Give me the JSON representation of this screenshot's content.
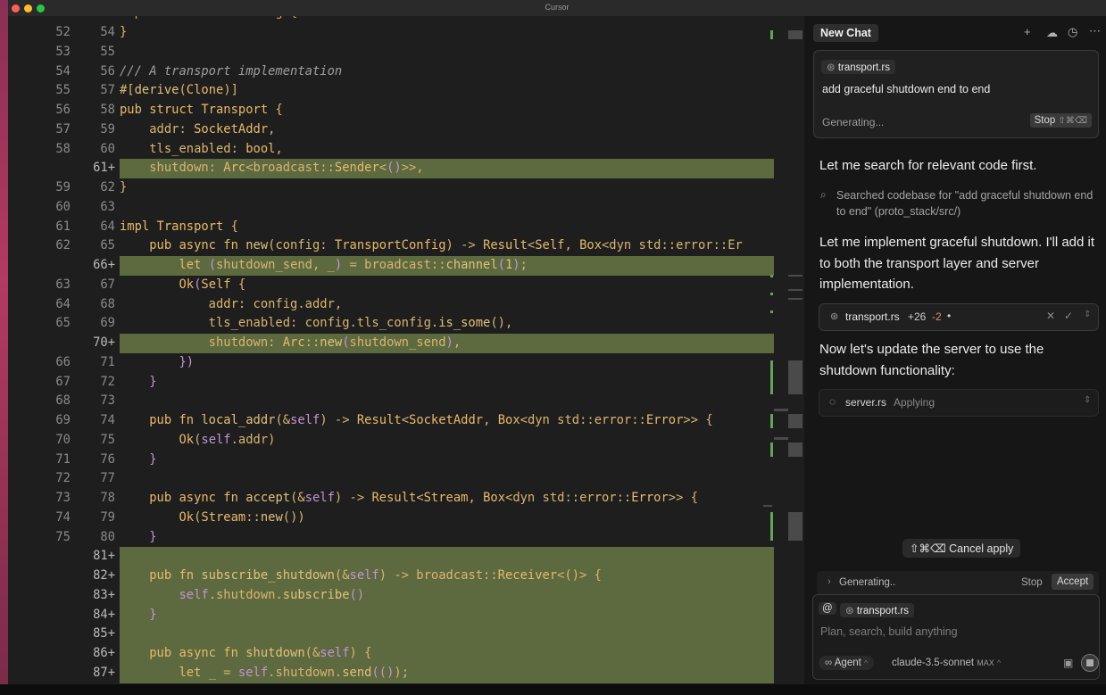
{
  "window": {
    "title": "Cursor"
  },
  "code_lines": [
    {
      "old": "52",
      "new": "54",
      "added": false,
      "code": [
        [
          "}",
          "t"
        ]
      ]
    },
    {
      "old": "53",
      "new": "55",
      "added": false,
      "code": []
    },
    {
      "old": "54",
      "new": "56",
      "added": false,
      "code": [
        [
          "/// A transport implementation",
          "c"
        ]
      ]
    },
    {
      "old": "55",
      "new": "57",
      "added": false,
      "code": [
        [
          "#[",
          "t"
        ],
        [
          "derive",
          "f"
        ],
        [
          "(",
          "t"
        ],
        [
          "Clone",
          "k"
        ],
        [
          ")]",
          "t"
        ]
      ]
    },
    {
      "old": "56",
      "new": "58",
      "added": false,
      "code": [
        [
          "pub struct ",
          "k"
        ],
        [
          "Transport",
          "k"
        ],
        [
          " {",
          "t"
        ]
      ]
    },
    {
      "old": "57",
      "new": "59",
      "added": false,
      "code": [
        [
          "    addr: ",
          "t"
        ],
        [
          "SocketAddr",
          "k"
        ],
        [
          ",",
          "t"
        ]
      ]
    },
    {
      "old": "58",
      "new": "60",
      "added": false,
      "code": [
        [
          "    tls_enabled: ",
          "t"
        ],
        [
          "bool",
          "k"
        ],
        [
          ",",
          "t"
        ]
      ]
    },
    {
      "old": "",
      "new": "61+",
      "added": true,
      "code": [
        [
          "    shutdown: ",
          "t"
        ],
        [
          "Arc",
          "k"
        ],
        [
          "<broadcast::",
          "t"
        ],
        [
          "Sender",
          "k"
        ],
        [
          "<",
          "t"
        ],
        [
          "()",
          "p"
        ],
        [
          ">>,",
          "t"
        ]
      ]
    },
    {
      "old": "59",
      "new": "62",
      "added": false,
      "code": [
        [
          "}",
          "t"
        ]
      ]
    },
    {
      "old": "60",
      "new": "63",
      "added": false,
      "code": []
    },
    {
      "old": "61",
      "new": "64",
      "added": false,
      "code": [
        [
          "impl ",
          "k"
        ],
        [
          "Transport",
          "k"
        ],
        [
          " {",
          "t"
        ]
      ]
    },
    {
      "old": "62",
      "new": "65",
      "added": false,
      "code": [
        [
          "    pub async fn ",
          "k"
        ],
        [
          "new",
          "f"
        ],
        [
          "(config: ",
          "t"
        ],
        [
          "TransportConfig",
          "k"
        ],
        [
          ") -> ",
          "t"
        ],
        [
          "Result",
          "k"
        ],
        [
          "<",
          "t"
        ],
        [
          "Self",
          "k"
        ],
        [
          ", ",
          "t"
        ],
        [
          "Box",
          "k"
        ],
        [
          "<dyn std::error::Er",
          "t"
        ]
      ]
    },
    {
      "old": "",
      "new": "66+",
      "added": true,
      "code": [
        [
          "        let ",
          "k"
        ],
        [
          "(",
          "p"
        ],
        [
          "shutdown_send, _",
          "t"
        ],
        [
          ")",
          "p"
        ],
        [
          " = broadcast::",
          "t"
        ],
        [
          "channel",
          "f"
        ],
        [
          "(",
          "p"
        ],
        [
          "1",
          "f"
        ],
        [
          ")",
          "p"
        ],
        [
          ";",
          "t"
        ]
      ]
    },
    {
      "old": "63",
      "new": "67",
      "added": false,
      "code": [
        [
          "        Ok",
          "k"
        ],
        [
          "(",
          "p"
        ],
        [
          "Self",
          "k"
        ],
        [
          " {",
          "t"
        ]
      ]
    },
    {
      "old": "64",
      "new": "68",
      "added": false,
      "code": [
        [
          "            addr: config.addr,",
          "t"
        ]
      ]
    },
    {
      "old": "65",
      "new": "69",
      "added": false,
      "code": [
        [
          "            tls_enabled: config.tls_config.",
          "t"
        ],
        [
          "is_some",
          "f"
        ],
        [
          "(),",
          "t"
        ]
      ]
    },
    {
      "old": "",
      "new": "70+",
      "added": true,
      "code": [
        [
          "            shutdown: ",
          "t"
        ],
        [
          "Arc",
          "k"
        ],
        [
          "::",
          "t"
        ],
        [
          "new",
          "f"
        ],
        [
          "(",
          "p"
        ],
        [
          "shutdown_send",
          "t"
        ],
        [
          ")",
          "p"
        ],
        [
          ",",
          "t"
        ]
      ]
    },
    {
      "old": "66",
      "new": "71",
      "added": false,
      "code": [
        [
          "        })",
          "p"
        ]
      ]
    },
    {
      "old": "67",
      "new": "72",
      "added": false,
      "code": [
        [
          "    }",
          "p"
        ]
      ]
    },
    {
      "old": "68",
      "new": "73",
      "added": false,
      "code": []
    },
    {
      "old": "69",
      "new": "74",
      "added": false,
      "code": [
        [
          "    pub fn ",
          "k"
        ],
        [
          "local_addr",
          "f"
        ],
        [
          "(&",
          "t"
        ],
        [
          "self",
          "p"
        ],
        [
          ") -> ",
          "t"
        ],
        [
          "Result",
          "k"
        ],
        [
          "<",
          "t"
        ],
        [
          "SocketAddr",
          "k"
        ],
        [
          ", ",
          "t"
        ],
        [
          "Box",
          "k"
        ],
        [
          "<dyn std::error::",
          "t"
        ],
        [
          "Error",
          "k"
        ],
        [
          ">> {",
          "t"
        ]
      ]
    },
    {
      "old": "70",
      "new": "75",
      "added": false,
      "code": [
        [
          "        Ok",
          "k"
        ],
        [
          "(",
          "t"
        ],
        [
          "self",
          "p"
        ],
        [
          ".addr)",
          "t"
        ]
      ]
    },
    {
      "old": "71",
      "new": "76",
      "added": false,
      "code": [
        [
          "    }",
          "p"
        ]
      ]
    },
    {
      "old": "72",
      "new": "77",
      "added": false,
      "code": []
    },
    {
      "old": "73",
      "new": "78",
      "added": false,
      "code": [
        [
          "    pub async fn ",
          "k"
        ],
        [
          "accept",
          "f"
        ],
        [
          "(&",
          "t"
        ],
        [
          "self",
          "p"
        ],
        [
          ") -> ",
          "t"
        ],
        [
          "Result",
          "k"
        ],
        [
          "<",
          "t"
        ],
        [
          "Stream",
          "k"
        ],
        [
          ", ",
          "t"
        ],
        [
          "Box",
          "k"
        ],
        [
          "<dyn std::error::",
          "t"
        ],
        [
          "Error",
          "k"
        ],
        [
          ">> {",
          "t"
        ]
      ]
    },
    {
      "old": "74",
      "new": "79",
      "added": false,
      "code": [
        [
          "        Ok",
          "k"
        ],
        [
          "(",
          "t"
        ],
        [
          "Stream",
          "k"
        ],
        [
          "::",
          "t"
        ],
        [
          "new",
          "f"
        ],
        [
          "())",
          "t"
        ]
      ]
    },
    {
      "old": "75",
      "new": "80",
      "added": false,
      "code": [
        [
          "    }",
          "p"
        ]
      ]
    },
    {
      "old": "",
      "new": "81+",
      "added": true,
      "code": []
    },
    {
      "old": "",
      "new": "82+",
      "added": true,
      "code": [
        [
          "    pub fn ",
          "k"
        ],
        [
          "subscribe_shutdown",
          "f"
        ],
        [
          "(&",
          "t"
        ],
        [
          "self",
          "p"
        ],
        [
          ") -> broadcast::",
          "t"
        ],
        [
          "Receiver",
          "k"
        ],
        [
          "<()> {",
          "t"
        ]
      ]
    },
    {
      "old": "",
      "new": "83+",
      "added": true,
      "code": [
        [
          "        self",
          "p"
        ],
        [
          ".shutdown.",
          "t"
        ],
        [
          "subscribe",
          "f"
        ],
        [
          "()",
          "p"
        ]
      ]
    },
    {
      "old": "",
      "new": "84+",
      "added": true,
      "code": [
        [
          "    }",
          "p"
        ]
      ]
    },
    {
      "old": "",
      "new": "85+",
      "added": true,
      "code": []
    },
    {
      "old": "",
      "new": "86+",
      "added": true,
      "code": [
        [
          "    pub async fn ",
          "k"
        ],
        [
          "shutdown",
          "f"
        ],
        [
          "(&",
          "t"
        ],
        [
          "self",
          "p"
        ],
        [
          ") {",
          "t"
        ]
      ]
    },
    {
      "old": "",
      "new": "87+",
      "added": true,
      "code": [
        [
          "        let ",
          "k"
        ],
        [
          "_ = ",
          "t"
        ],
        [
          "self",
          "p"
        ],
        [
          ".shutdown.",
          "t"
        ],
        [
          "send",
          "f"
        ],
        [
          "(",
          "p"
        ],
        [
          "()",
          "p"
        ],
        [
          ");",
          "t"
        ]
      ]
    }
  ],
  "chat": {
    "tab_label": "New Chat",
    "header_icons": [
      "plus-icon",
      "cloud-icon",
      "history-icon",
      "more-icon"
    ],
    "prompt": {
      "file_chip": "transport.rs",
      "text": "add graceful shutdown end to end",
      "status": "Generating...",
      "stop_label": "Stop",
      "stop_shortcut": "⇧⌘⌫"
    },
    "msg1": "Let me search for relevant code first.",
    "search_result": "Searched codebase for \"add graceful shutdown end to end\" (proto_stack/src/)",
    "msg2": "Let me implement graceful shutdown. I'll add it to both the transport layer and server implementation.",
    "edit1": {
      "file": "transport.rs",
      "added": "+26",
      "removed": "-2",
      "dot": "•"
    },
    "msg3": "Now let's update the server to use the shutdown functionality:",
    "edit2": {
      "file": "server.rs",
      "status": "Applying"
    },
    "cancel_apply": {
      "shortcut": "⇧⌘⌫",
      "label": "Cancel apply"
    },
    "generating_bar": {
      "label": "Generating..",
      "stop": "Stop",
      "accept": "Accept"
    },
    "composer": {
      "at": "@",
      "file_chip": "transport.rs",
      "placeholder": "Plan, search, build anything",
      "mode": "Agent",
      "model": "claude-3.5-sonnet",
      "max_badge": "MAX"
    }
  },
  "colors": {
    "added_bg": "#5d6a3f",
    "accent_green": "#63a35a"
  }
}
